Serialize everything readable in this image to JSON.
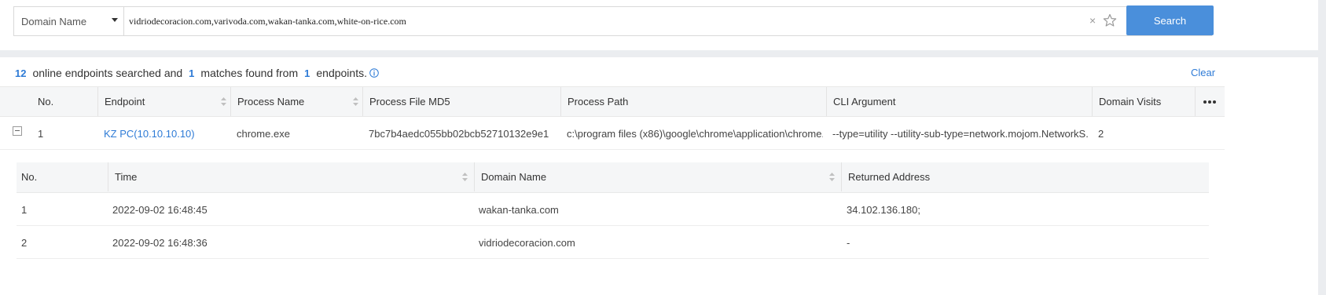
{
  "search": {
    "field": "Domain Name",
    "query": "vidriodecoracion.com,varivoda.com,wakan-tanka.com,white-on-rice.com",
    "button": "Search",
    "clear_glyph": "×"
  },
  "summary": {
    "endpoints_searched": "12",
    "text1": "online endpoints searched and",
    "matches": "1",
    "text2": "matches found from",
    "endpoints": "1",
    "text3": "endpoints.",
    "clear": "Clear"
  },
  "icons": {
    "info": "info-circle-icon",
    "star": "star-icon",
    "more": "more-horizontal-icon",
    "collapse": "minus-square-icon",
    "sort": "sort-icon"
  },
  "colors": {
    "accent": "#4a8fdb",
    "link": "#2e7bd6"
  },
  "table": {
    "headers": {
      "no": "No.",
      "endpoint": "Endpoint",
      "process_name": "Process Name",
      "md5": "Process File MD5",
      "path": "Process Path",
      "cli": "CLI Argument",
      "visits": "Domain Visits"
    },
    "rows": [
      {
        "no": "1",
        "endpoint": "KZ PC(10.10.10.10)",
        "process_name": "chrome.exe",
        "md5": "7bc7b4aedc055bb02bcb52710132e9e1",
        "path": "c:\\program files (x86)\\google\\chrome\\application\\chrome...",
        "cli": "--type=utility --utility-sub-type=network.mojom.NetworkS...",
        "visits": "2"
      }
    ]
  },
  "detail": {
    "headers": {
      "no": "No.",
      "time": "Time",
      "domain": "Domain Name",
      "address": "Returned Address"
    },
    "rows": [
      {
        "no": "1",
        "time": "2022-09-02 16:48:45",
        "domain": "wakan-tanka.com",
        "address": "34.102.136.180;"
      },
      {
        "no": "2",
        "time": "2022-09-02 16:48:36",
        "domain": "vidriodecoracion.com",
        "address": "-"
      }
    ]
  }
}
